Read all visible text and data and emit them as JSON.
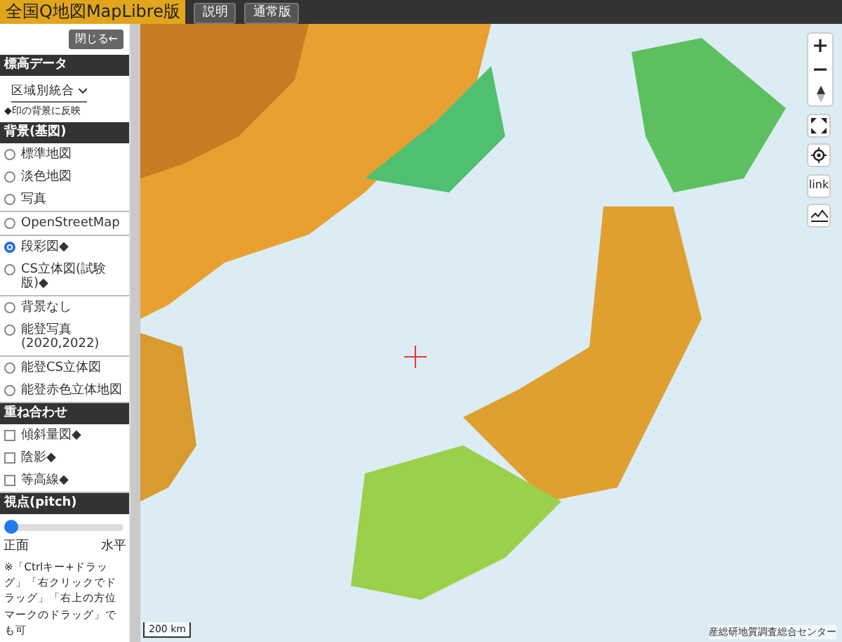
{
  "header": {
    "title": "全国Q地図MapLibre版",
    "buttons": [
      "説明",
      "通常版"
    ]
  },
  "panel": {
    "close_button": "閉じる←",
    "sections": [
      {
        "kind": "select",
        "title": "標高データ",
        "value": "区域別統合",
        "note": "◆印の背景に反映"
      },
      {
        "kind": "radio",
        "title": "背景(基図)",
        "groups": [
          [
            {
              "label": "標準地図",
              "selected": false
            },
            {
              "label": "淡色地図",
              "selected": false
            },
            {
              "label": "写真",
              "selected": false
            }
          ],
          [
            {
              "label": "OpenStreetMap",
              "selected": false
            }
          ],
          [
            {
              "label": "段彩図◆",
              "selected": true
            },
            {
              "label": "CS立体図(試験版)◆",
              "selected": false
            }
          ],
          [
            {
              "label": "背景なし",
              "selected": false
            },
            {
              "label": "能登写真(2020,2022)",
              "selected": false
            }
          ],
          [
            {
              "label": "能登CS立体図",
              "selected": false
            },
            {
              "label": "能登赤色立体地図",
              "selected": false
            }
          ]
        ]
      },
      {
        "kind": "check",
        "title": "重ね合わせ",
        "items": [
          {
            "label": "傾斜量図◆",
            "checked": false
          },
          {
            "label": "陰影◆",
            "checked": false
          },
          {
            "label": "等高線◆",
            "checked": false
          }
        ]
      },
      {
        "kind": "slider",
        "title": "視点(pitch)",
        "level": 0,
        "min_label": "正面",
        "max_label": "水平",
        "note": "※「Ctrlキー+ドラッグ」「右クリックでドラッグ」「右上の方位マークのドラッグ」でも可"
      }
    ]
  },
  "map": {
    "scale": "200 km",
    "link_button": "link",
    "attribution": "産総研地質調査総合センター"
  }
}
